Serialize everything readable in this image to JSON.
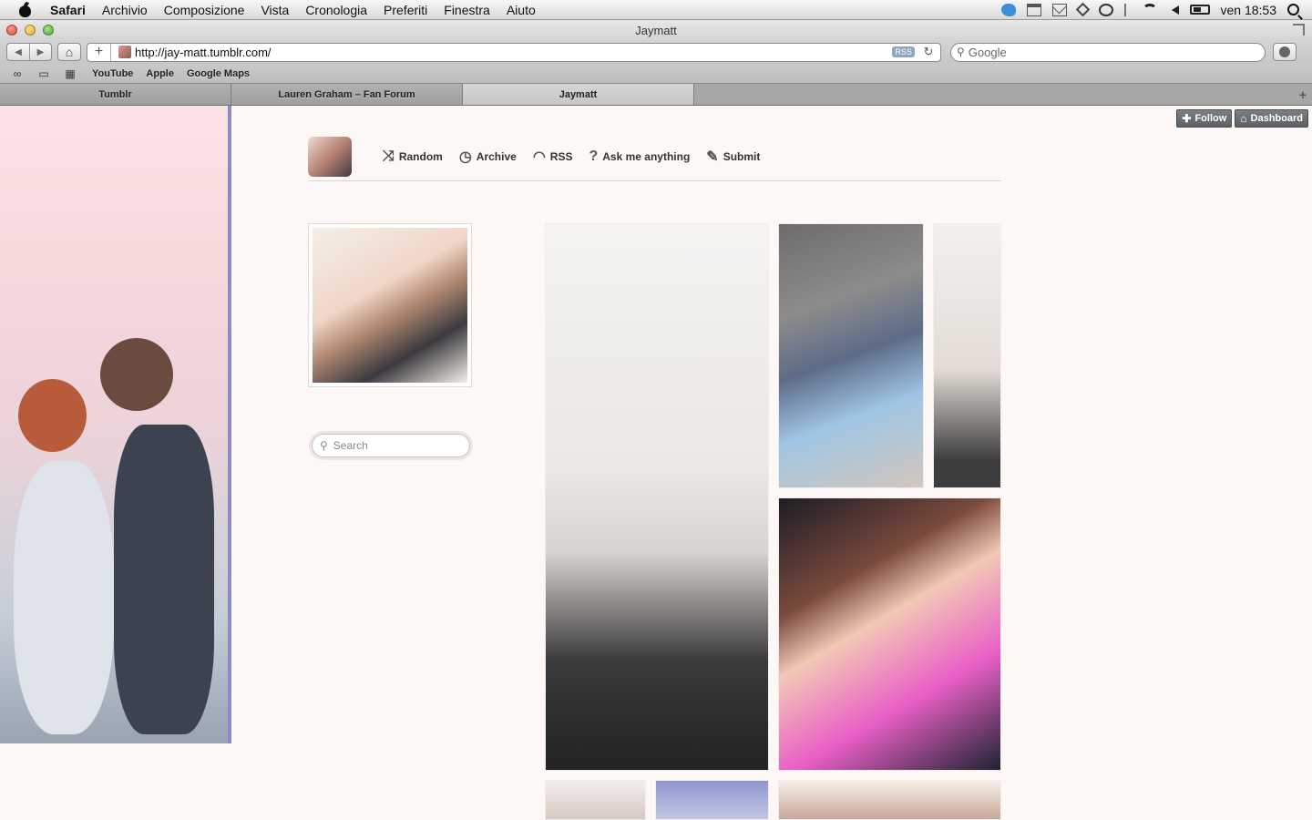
{
  "menubar": {
    "app_name": "Safari",
    "menus": [
      "Archivio",
      "Composizione",
      "Vista",
      "Cronologia",
      "Preferiti",
      "Finestra",
      "Aiuto"
    ],
    "status_icons": [
      "twitter-icon",
      "calendar-icon",
      "mail-icon",
      "dropbox-icon",
      "time-machine-icon",
      "bluetooth-icon",
      "wifi-icon",
      "volume-icon",
      "battery-icon"
    ],
    "clock": "ven 18:53"
  },
  "window": {
    "title": "Jaymatt"
  },
  "toolbar": {
    "url": "http://jay-matt.tumblr.com/",
    "rss_label": "RSS",
    "search_placeholder": "Google"
  },
  "bookmarks": {
    "items": [
      "YouTube",
      "Apple",
      "Google Maps"
    ]
  },
  "tabs": {
    "items": [
      "Tumblr",
      "Lauren Graham – Fan Forum",
      "Jaymatt"
    ],
    "active_index": 2
  },
  "tumblr_controls": {
    "follow": "Follow",
    "dashboard": "Dashboard"
  },
  "blog_nav": {
    "links": [
      "Random",
      "Archive",
      "RSS",
      "Ask me anything",
      "Submit"
    ]
  },
  "sidebar": {
    "search_placeholder": "Search"
  },
  "colors": {
    "page_background": "#fdf7f6",
    "sidebar_border": "#8a8dc4",
    "tumblr_button": "#6c6f74"
  }
}
